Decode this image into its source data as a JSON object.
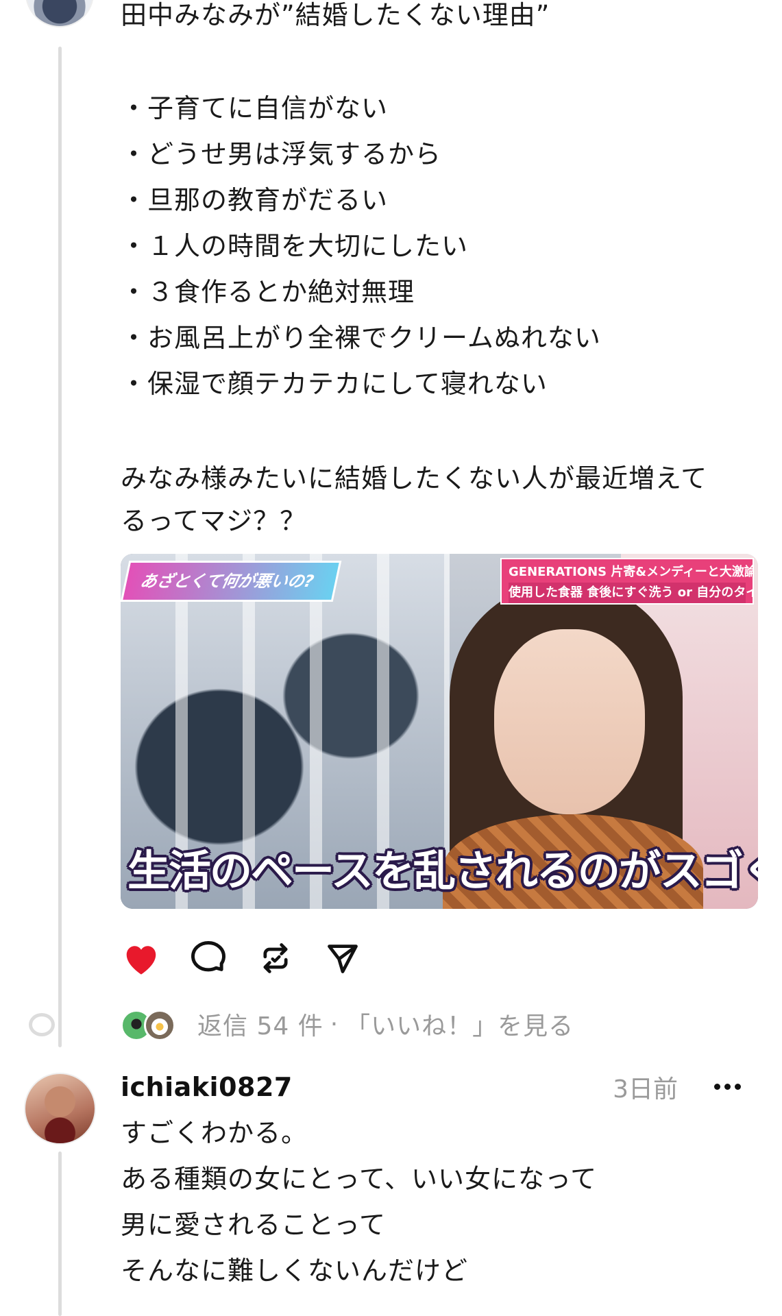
{
  "post": {
    "title": "田中みなみが”結婚したくない理由”",
    "bullets": [
      "・子育てに自信がない",
      "・どうせ男は浮気するから",
      "・旦那の教育がだるい",
      "・１人の時間を大切にしたい",
      "・３食作るとか絶対無理",
      "・お風呂上がり全裸でクリームぬれない",
      "・保湿で顔テカテカにして寝れない"
    ],
    "question_line1": "みなみ様みたいに結婚したくない人が最近増えて",
    "question_line2": "るってマジ？？",
    "media": {
      "logo_text": "あざとくて何が悪いの?",
      "topic_line1": "GENERATIONS 片寄&メンディーと大激論!!",
      "topic_line2": "使用した食器 食後にすぐ洗う or 自分のタイミングで",
      "caption": "生活のペースを乱されるのがスゴく嫌"
    },
    "actions": {
      "like_icon": "heart-filled-icon",
      "comment_icon": "comment-bubble-icon",
      "repost_icon": "repost-icon",
      "share_icon": "send-icon",
      "like_color": "#e8192c"
    },
    "replies": {
      "count_text": "返信 54 件",
      "separator": "·",
      "likes_link": "「いいね！」を見る"
    }
  },
  "comment": {
    "username": "ichiaki0827",
    "timestamp": "3日前",
    "lines": [
      "すごくわかる。",
      "ある種類の女にとって、いい女になって",
      "男に愛されることって",
      "そんなに難しくないんだけど"
    ]
  }
}
